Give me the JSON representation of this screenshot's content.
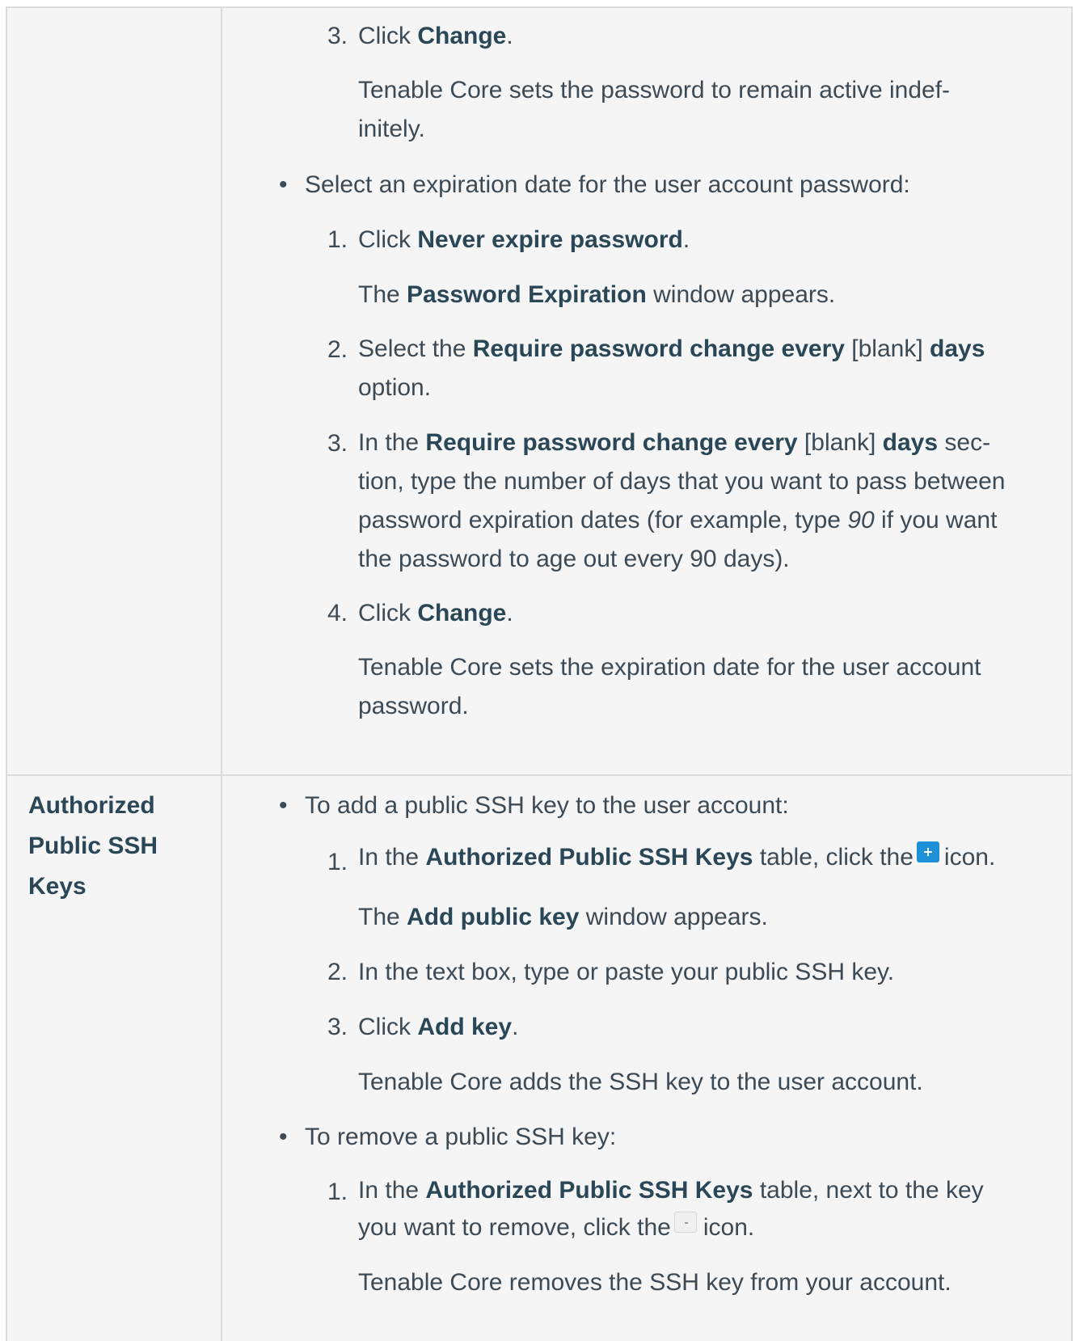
{
  "row1": {
    "step_prev3": {
      "num": "3.",
      "pre": "Click ",
      "bold": "Change",
      "post": "."
    },
    "step_prev3_result_l1": "Tenable Core sets the password to remain active indef-",
    "step_prev3_result_l2": "initely.",
    "bullet": "Select an expiration date for the user account password:",
    "step1": {
      "num": "1.",
      "pre": "Click ",
      "bold": "Never expire password",
      "post": "."
    },
    "step1_result": {
      "pre": "The ",
      "bold": "Password Expiration",
      "post": " window appears."
    },
    "step2": {
      "num": "2.",
      "pre": "Select the ",
      "bold1": "Require password change every",
      "mid": " [blank] ",
      "bold2": "days",
      "l2": "option."
    },
    "step3": {
      "num": "3.",
      "pre": "In the ",
      "bold1": "Require password change every",
      "mid": " [blank] ",
      "bold2": "days",
      "post": " sec-",
      "l2": "tion, type the number of days that you want to pass between",
      "l3_pre": "password expiration dates (for example, type ",
      "l3_em": "90",
      "l3_post": " if you want",
      "l4": "the password to age out every 90 days)."
    },
    "step4": {
      "num": "4.",
      "pre": "Click ",
      "bold": "Change",
      "post": "."
    },
    "step4_result_l1": "Tenable Core sets the expiration date for the user account",
    "step4_result_l2": "password."
  },
  "row2": {
    "label_l1": "Authorized",
    "label_l2": "Public SSH",
    "label_l3": "Keys",
    "bullet_add": "To add a public SSH key to the user account:",
    "add1": {
      "num": "1.",
      "pre": "In the ",
      "bold": "Authorized Public SSH Keys",
      "post1": " table, click the",
      "post2": "icon."
    },
    "add1_result": {
      "pre": "The ",
      "bold": "Add public key",
      "post": " window appears."
    },
    "add2": {
      "num": "2.",
      "text": "In the text box, type or paste your public SSH key."
    },
    "add3": {
      "num": "3.",
      "pre": "Click ",
      "bold": "Add key",
      "post": "."
    },
    "add3_result": "Tenable Core adds the SSH key to the user account.",
    "bullet_remove": "To remove a public SSH key:",
    "rem1": {
      "num": "1.",
      "pre": "In the ",
      "bold": "Authorized Public SSH Keys",
      "post": " table, next to the key",
      "l2_pre": "you want to remove, click the",
      "l2_post": "icon."
    },
    "rem1_result": "Tenable Core removes the SSH key from your account."
  },
  "icons": {
    "plus": "plus-icon",
    "minus": "minus-icon"
  }
}
